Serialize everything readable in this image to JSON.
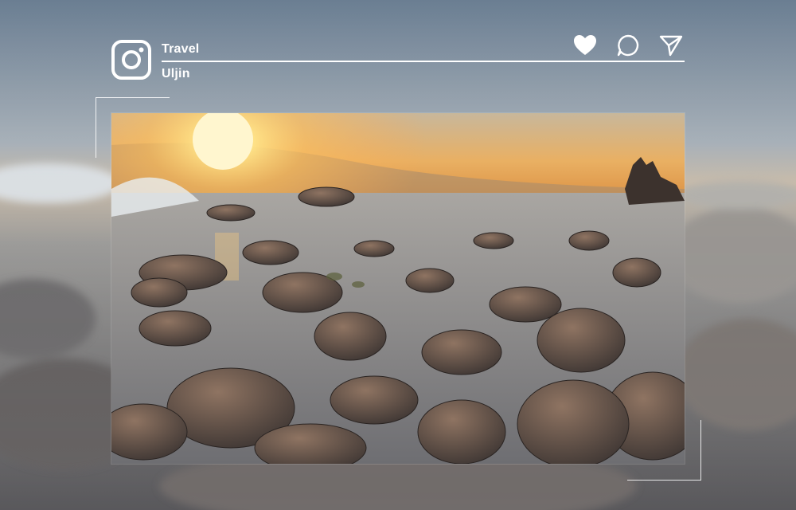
{
  "post": {
    "category": "Travel",
    "location": "Uljin"
  },
  "icons": {
    "logo": "instagram-icon",
    "like": "heart-icon",
    "comment": "comment-icon",
    "share": "send-icon"
  },
  "colors": {
    "overlay_text": "#ffffff",
    "sky_top": "#5d7288",
    "sun": "#ffd772"
  }
}
